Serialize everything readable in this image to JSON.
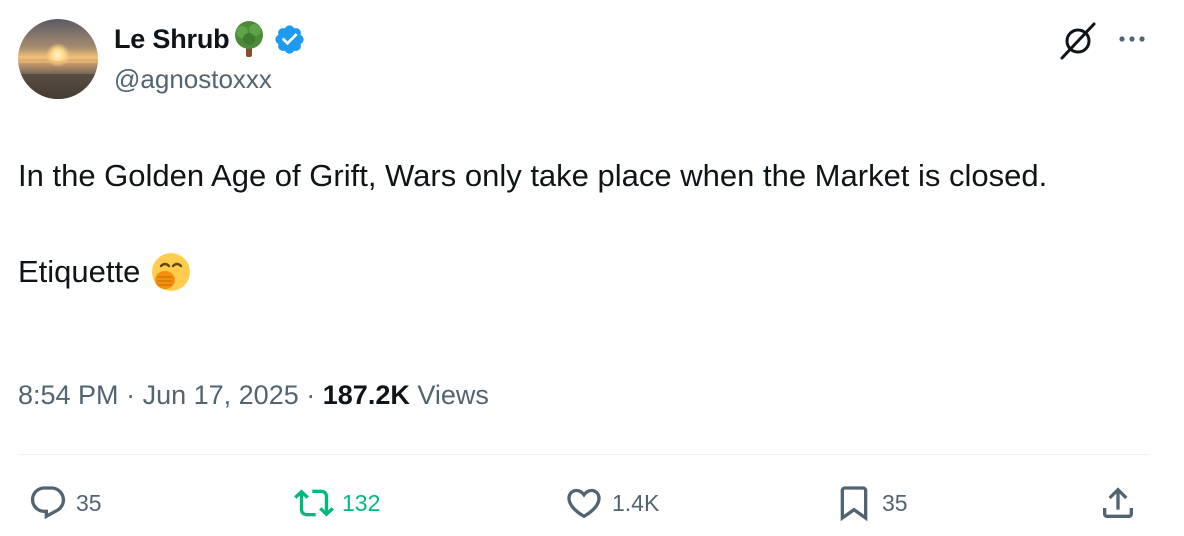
{
  "author": {
    "display_name": "Le Shrub",
    "name_emoji": "tree-emoji",
    "verified": true,
    "handle": "@agnostoxxx",
    "avatar": "sunset-beach-photo"
  },
  "header_actions": {
    "grok_icon": "grok-icon",
    "more_icon": "more-icon"
  },
  "tweet": {
    "line1": "In the Golden Age of Grift, Wars only take place when the Market is closed.",
    "line2": "Etiquette",
    "line2_emoji": "hand-over-mouth-emoji"
  },
  "meta": {
    "time": "8:54 PM",
    "separator": "·",
    "date": "Jun 17, 2025",
    "views_count": "187.2K",
    "views_label": "Views"
  },
  "actions": {
    "replies": "35",
    "reposts": "132",
    "likes": "1.4K",
    "bookmarks": "35"
  },
  "colors": {
    "text_primary": "#0f1419",
    "text_secondary": "#536471",
    "verified_blue": "#1d9bf0",
    "repost_green": "#00ba7c",
    "divider": "#eff3f4"
  }
}
